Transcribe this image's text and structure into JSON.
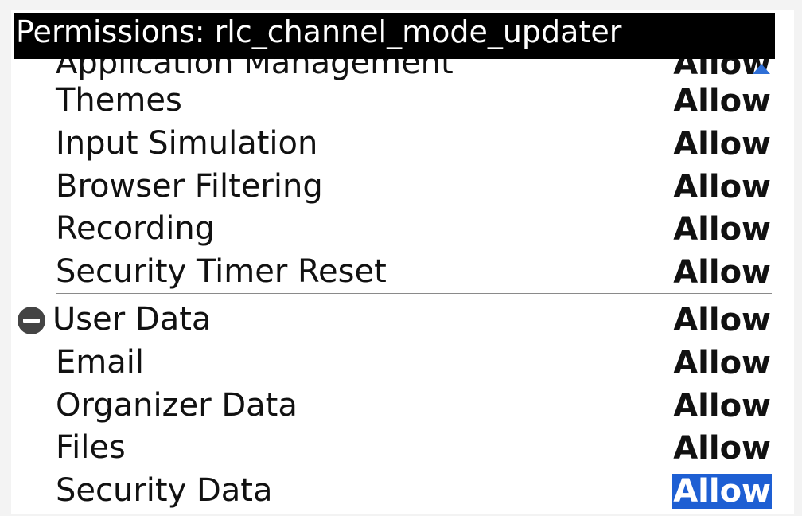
{
  "window": {
    "title": "Permissions: rlc_channel_mode_updater"
  },
  "permissions": {
    "items": [
      {
        "label": "Application Management",
        "value": "Allow",
        "partial": true
      },
      {
        "label": "Themes",
        "value": "Allow"
      },
      {
        "label": "Input Simulation",
        "value": "Allow"
      },
      {
        "label": "Browser Filtering",
        "value": "Allow"
      },
      {
        "label": "Recording",
        "value": "Allow"
      },
      {
        "label": "Security Timer Reset",
        "value": "Allow"
      },
      {
        "label": "User Data",
        "value": "Allow",
        "group_header": true,
        "expanded": true
      },
      {
        "label": "Email",
        "value": "Allow"
      },
      {
        "label": "Organizer Data",
        "value": "Allow"
      },
      {
        "label": "Files",
        "value": "Allow"
      },
      {
        "label": "Security Data",
        "value": "Allow",
        "selected": true
      }
    ]
  },
  "colors": {
    "title_background": "#000000",
    "title_text": "#ffffff",
    "selection": "#1e5fd3",
    "scroll_arrow": "#2f6fd6"
  },
  "icons": {
    "collapse": "minus-circle-icon",
    "scroll_up": "up-triangle-icon"
  }
}
